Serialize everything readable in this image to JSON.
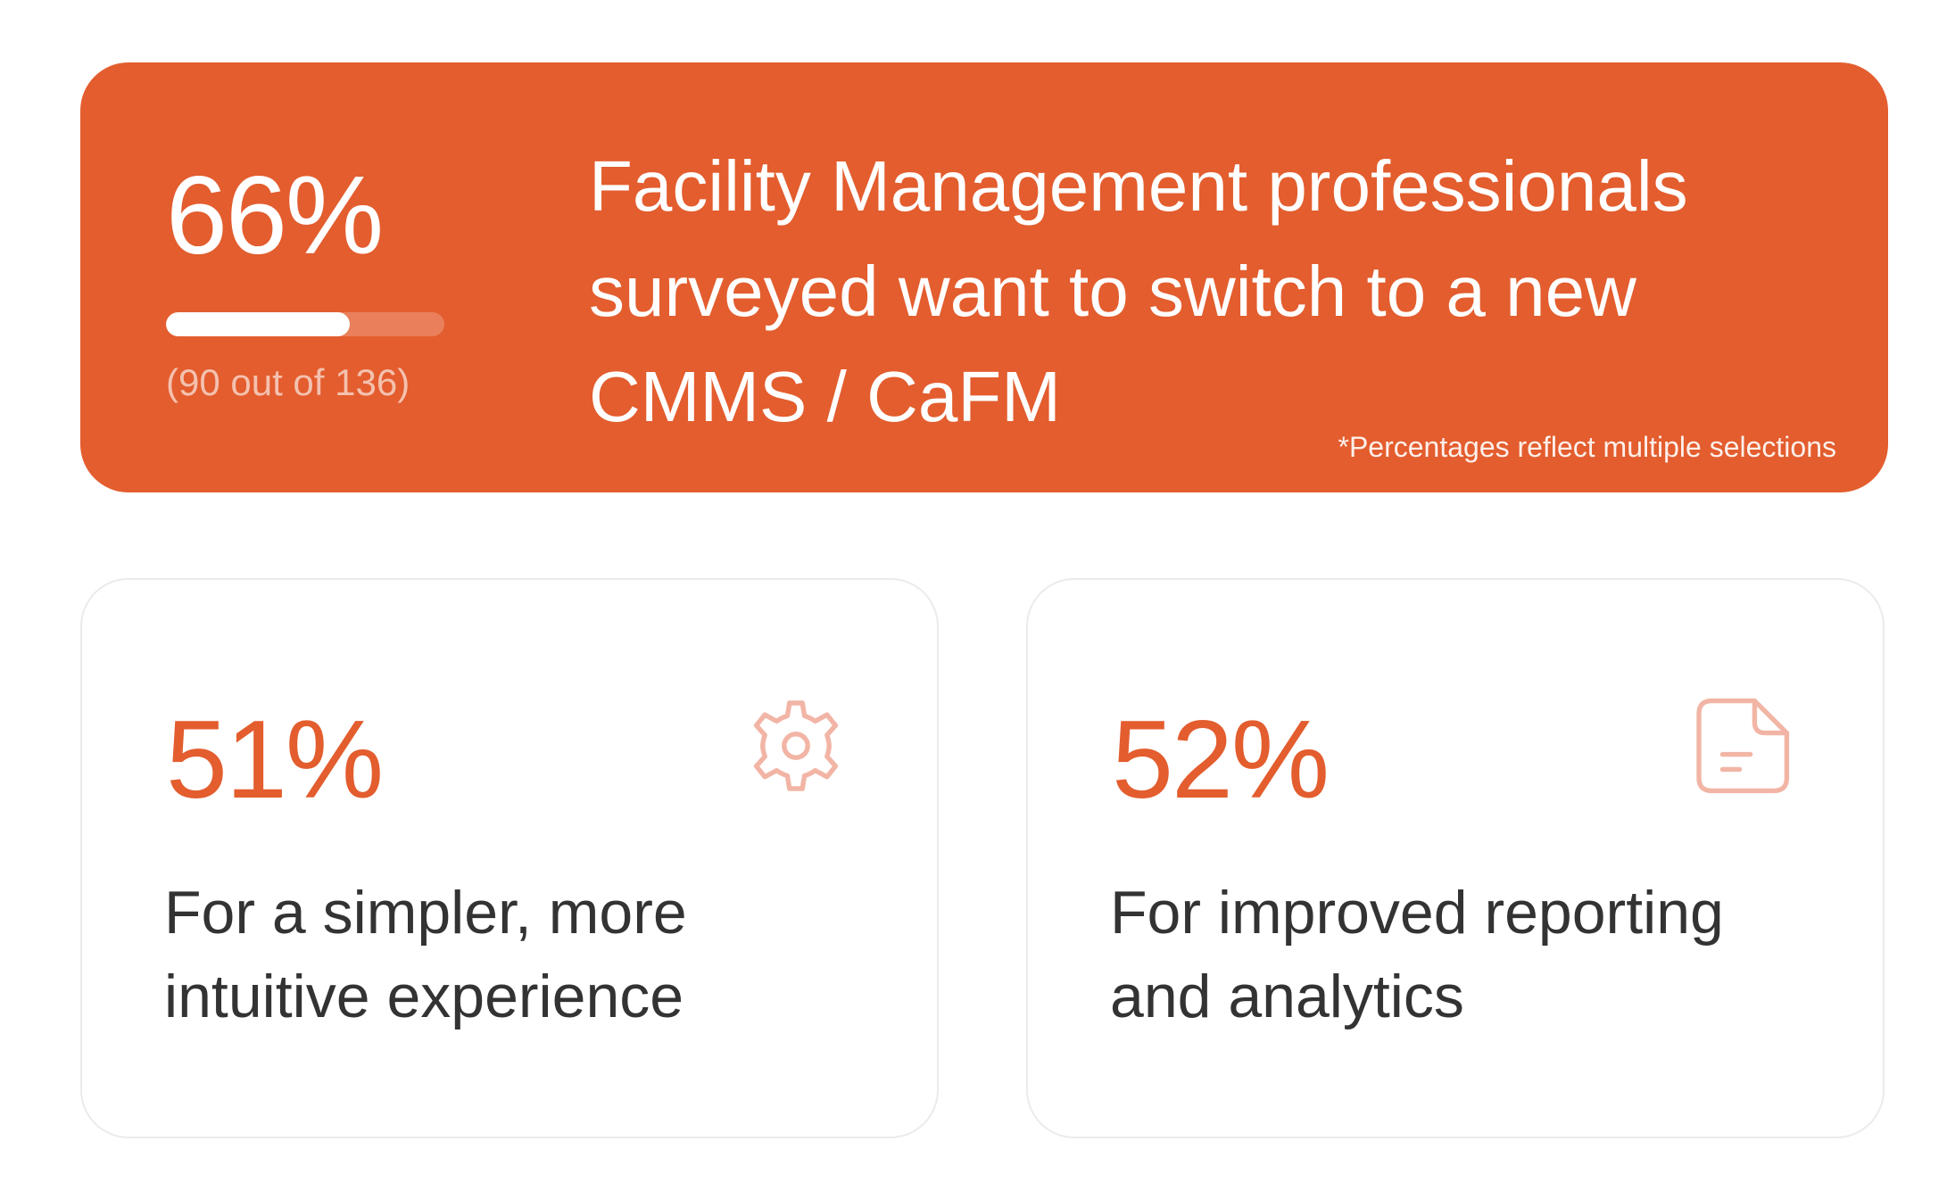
{
  "hero": {
    "percent": "66%",
    "progress_fraction": 0.66,
    "count": "(90 out of 136)",
    "headline": "Facility Management professionals surveyed want to switch to a new CMMS / CaFM",
    "note": "*Percentages reflect multiple selections"
  },
  "cards": [
    {
      "percent": "51%",
      "description": "For a simpler, more intuitive experience",
      "icon": "gear-icon"
    },
    {
      "percent": "52%",
      "description": "For improved reporting and analytics",
      "icon": "document-icon"
    }
  ],
  "colors": {
    "accent": "#e35d2e",
    "icon": "#f2b5a5",
    "text": "#333333",
    "card_border": "#ebebeb"
  }
}
